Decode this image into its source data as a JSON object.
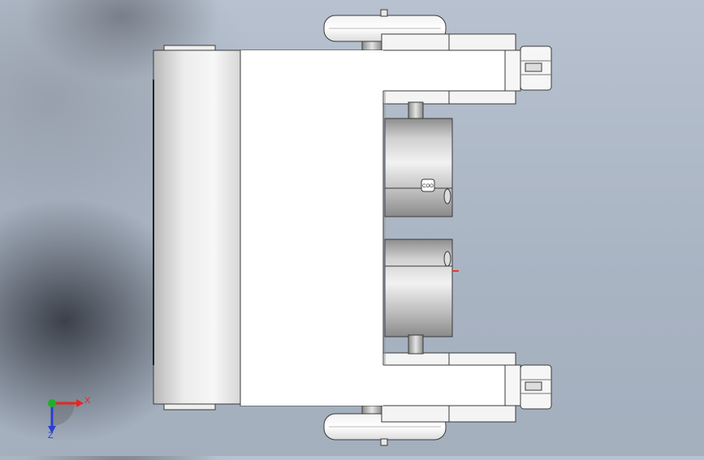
{
  "viewport": {
    "background_colors": [
      "#b7c1cf",
      "#a4afbe"
    ],
    "model": {
      "part_colors": {
        "body": "#ffffff",
        "outline": "#3a3a3a",
        "motor_metal": "#a8a8a8",
        "shaft": "#9a9a9a",
        "marker": "#e53b2a"
      },
      "button_label": "COO"
    }
  },
  "triad": {
    "x_label": "X",
    "z_label": "Z",
    "x_color": "#e02a20",
    "y_color": "#1fb02a",
    "z_color": "#2a3fd0"
  }
}
